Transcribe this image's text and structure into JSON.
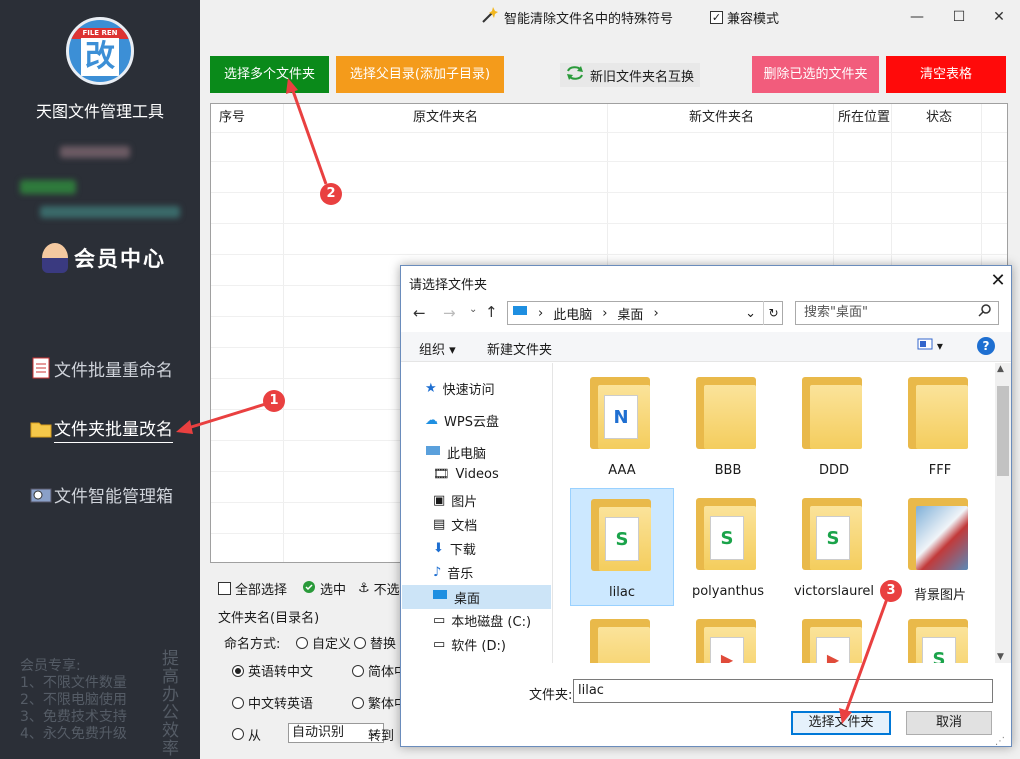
{
  "sidebar": {
    "logo_band": "FILE REN",
    "logo_glyph": "改",
    "app_title": "天图文件管理工具",
    "vip_center": "会员中心",
    "menu": [
      {
        "label": "文件批量重命名"
      },
      {
        "label": "文件夹批量改名"
      },
      {
        "label": "文件智能管理箱"
      }
    ],
    "perks": [
      "会员专享:",
      "1、不限文件数量",
      "2、不限电脑使用",
      "3、免费技术支持",
      "4、永久免费升级"
    ],
    "slogan": "提高办公效率"
  },
  "topbar": {
    "feature": "智能清除文件名中的特殊符号",
    "compat_mode": "兼容模式",
    "compat_checked": true
  },
  "toolbar": {
    "select_multi": "选择多个文件夹",
    "select_parent": "选择父目录(添加子目录)",
    "swap": "新旧文件夹名互换",
    "delete_selected": "删除已选的文件夹",
    "clear_table": "清空表格",
    "colors": {
      "select_multi": "#0a8a1a",
      "select_parent": "#f49b1b",
      "delete_selected": "#f25c7c",
      "clear_table": "#ff0a0a"
    }
  },
  "table": {
    "headers": [
      "序号",
      "原文件夹名",
      "新文件夹名",
      "所在位置",
      "状态"
    ],
    "rows": []
  },
  "options": {
    "select_all": "全部选择",
    "selected": "选中",
    "unselected": "不选",
    "section_title": "文件夹名(目录名)",
    "naming_label": "命名方式:",
    "custom": "自定义",
    "replace": "替换",
    "en_to_cn": "英语转中文",
    "simplified": "简体中",
    "cn_to_en": "中文转英语",
    "traditional": "繁体中",
    "from_label": "从",
    "auto_detect": "自动识别",
    "to_label": "转到"
  },
  "dialog": {
    "title": "请选择文件夹",
    "breadcrumb": [
      "此电脑",
      "桌面"
    ],
    "search_placeholder": "搜索\"桌面\"",
    "organize": "组织",
    "new_folder": "新建文件夹",
    "nav": [
      {
        "label": "快速访问",
        "icon": "star-icon"
      },
      {
        "label": "WPS云盘",
        "icon": "cloud-icon"
      },
      {
        "label": "此电脑",
        "icon": "computer-icon"
      },
      {
        "label": "Videos",
        "icon": "video-icon"
      },
      {
        "label": "图片",
        "icon": "picture-icon"
      },
      {
        "label": "文档",
        "icon": "document-icon"
      },
      {
        "label": "下载",
        "icon": "download-icon"
      },
      {
        "label": "音乐",
        "icon": "music-icon"
      },
      {
        "label": "桌面",
        "icon": "desktop-icon"
      },
      {
        "label": "本地磁盘 (C:)",
        "icon": "disk-icon"
      },
      {
        "label": "软件 (D:)",
        "icon": "disk-icon"
      }
    ],
    "files": [
      {
        "name": "AAA",
        "badge": "N",
        "badge_color": "#1f6fd1"
      },
      {
        "name": "BBB",
        "badge": "",
        "badge_color": ""
      },
      {
        "name": "DDD",
        "badge": "",
        "badge_color": ""
      },
      {
        "name": "FFF",
        "badge": "",
        "badge_color": ""
      },
      {
        "name": "lilac",
        "badge": "S",
        "badge_color": "#1aa34a"
      },
      {
        "name": "polyanthus",
        "badge": "S",
        "badge_color": "#1aa34a"
      },
      {
        "name": "victorslaurel",
        "badge": "S",
        "badge_color": "#1aa34a"
      },
      {
        "name": "背景图片",
        "badge": "",
        "badge_color": ""
      },
      {
        "name": "",
        "badge": "",
        "badge_color": ""
      },
      {
        "name": "",
        "badge": "▶",
        "badge_color": "#e04b3a"
      },
      {
        "name": "",
        "badge": "▶",
        "badge_color": "#e04b3a"
      },
      {
        "name": "",
        "badge": "S",
        "badge_color": "#1aa34a"
      }
    ],
    "filename_label": "文件夹:",
    "filename_value": "lilac",
    "ok": "选择文件夹",
    "cancel": "取消"
  },
  "annotations": [
    "1",
    "2",
    "3"
  ]
}
